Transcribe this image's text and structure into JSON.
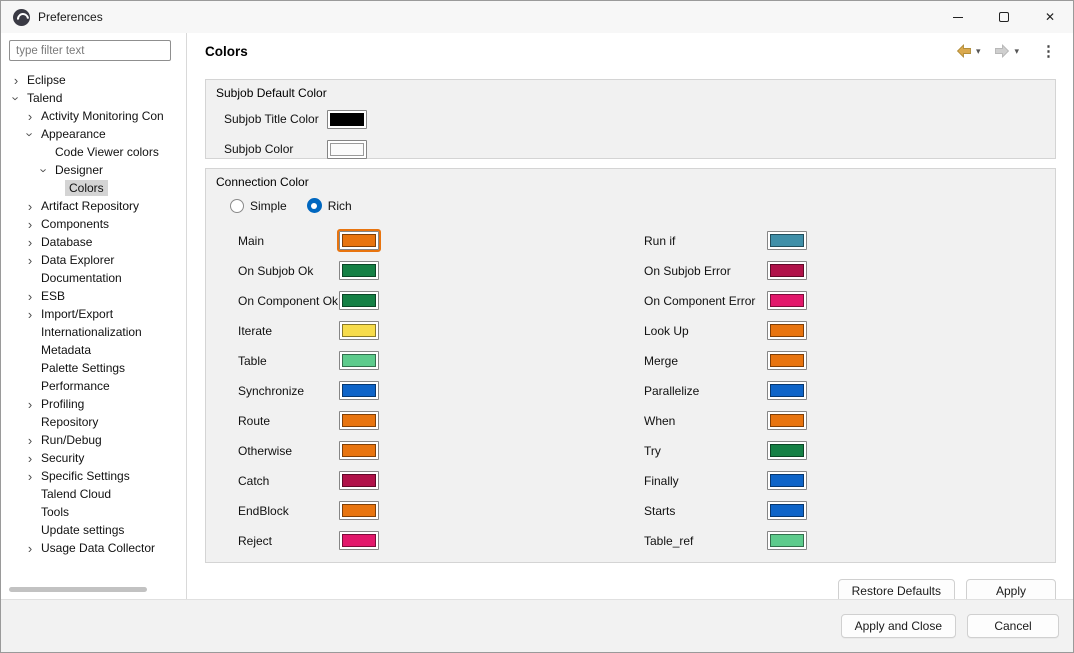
{
  "window": {
    "title": "Preferences"
  },
  "icons": {
    "close": "✕",
    "kebab": "⋮",
    "caret_down": "▾",
    "chevron": "›"
  },
  "sidebar": {
    "filter_placeholder": "type filter text",
    "tree": [
      {
        "label": "Eclipse",
        "level": 0,
        "arrow": "collapsed",
        "selected": false
      },
      {
        "label": "Talend",
        "level": 0,
        "arrow": "expanded",
        "selected": false
      },
      {
        "label": "Activity Monitoring Con",
        "level": 1,
        "arrow": "collapsed",
        "selected": false
      },
      {
        "label": "Appearance",
        "level": 1,
        "arrow": "expanded",
        "selected": false
      },
      {
        "label": "Code Viewer colors",
        "level": 2,
        "arrow": "none",
        "selected": false
      },
      {
        "label": "Designer",
        "level": 2,
        "arrow": "expanded",
        "selected": false
      },
      {
        "label": "Colors",
        "level": 3,
        "arrow": "none",
        "selected": true
      },
      {
        "label": "Artifact Repository",
        "level": 1,
        "arrow": "collapsed",
        "selected": false
      },
      {
        "label": "Components",
        "level": 1,
        "arrow": "collapsed",
        "selected": false
      },
      {
        "label": "Database",
        "level": 1,
        "arrow": "collapsed",
        "selected": false
      },
      {
        "label": "Data Explorer",
        "level": 1,
        "arrow": "collapsed",
        "selected": false
      },
      {
        "label": "Documentation",
        "level": 1,
        "arrow": "none",
        "selected": false
      },
      {
        "label": "ESB",
        "level": 1,
        "arrow": "collapsed",
        "selected": false
      },
      {
        "label": "Import/Export",
        "level": 1,
        "arrow": "collapsed",
        "selected": false
      },
      {
        "label": "Internationalization",
        "level": 1,
        "arrow": "none",
        "selected": false
      },
      {
        "label": "Metadata",
        "level": 1,
        "arrow": "none",
        "selected": false
      },
      {
        "label": "Palette Settings",
        "level": 1,
        "arrow": "none",
        "selected": false
      },
      {
        "label": "Performance",
        "level": 1,
        "arrow": "none",
        "selected": false
      },
      {
        "label": "Profiling",
        "level": 1,
        "arrow": "collapsed",
        "selected": false
      },
      {
        "label": "Repository",
        "level": 1,
        "arrow": "none",
        "selected": false
      },
      {
        "label": "Run/Debug",
        "level": 1,
        "arrow": "collapsed",
        "selected": false
      },
      {
        "label": "Security",
        "level": 1,
        "arrow": "collapsed",
        "selected": false
      },
      {
        "label": "Specific Settings",
        "level": 1,
        "arrow": "collapsed",
        "selected": false
      },
      {
        "label": "Talend Cloud",
        "level": 1,
        "arrow": "none",
        "selected": false
      },
      {
        "label": "Tools",
        "level": 1,
        "arrow": "none",
        "selected": false
      },
      {
        "label": "Update settings",
        "level": 1,
        "arrow": "none",
        "selected": false
      },
      {
        "label": "Usage Data Collector",
        "level": 1,
        "arrow": "collapsed",
        "selected": false
      }
    ]
  },
  "main": {
    "title": "Colors",
    "subjob_group": {
      "title": "Subjob Default Color",
      "rows": [
        {
          "label": "Subjob Title Color",
          "color": "#000000"
        },
        {
          "label": "Subjob Color",
          "color": "#FBFBFB"
        }
      ]
    },
    "connection_group": {
      "title": "Connection Color",
      "radios": [
        {
          "label": "Simple",
          "checked": false
        },
        {
          "label": "Rich",
          "checked": true
        }
      ],
      "left": [
        {
          "label": "Main",
          "color": "#E8740F",
          "focused": true
        },
        {
          "label": "On Subjob Ok",
          "color": "#158045"
        },
        {
          "label": "On Component Ok",
          "color": "#158045"
        },
        {
          "label": "Iterate",
          "color": "#F7DC4B"
        },
        {
          "label": "Table",
          "color": "#5DCB8C"
        },
        {
          "label": "Synchronize",
          "color": "#0E64C8"
        },
        {
          "label": "Route",
          "color": "#E8740F"
        },
        {
          "label": "Otherwise",
          "color": "#E8740F"
        },
        {
          "label": "Catch",
          "color": "#B01249"
        },
        {
          "label": "EndBlock",
          "color": "#E8740F"
        },
        {
          "label": "Reject",
          "color": "#E2186B"
        }
      ],
      "right": [
        {
          "label": "Run if",
          "color": "#3F8FA8"
        },
        {
          "label": "On Subjob Error",
          "color": "#B01249"
        },
        {
          "label": "On Component Error",
          "color": "#E2186B"
        },
        {
          "label": "Look Up",
          "color": "#E8740F"
        },
        {
          "label": "Merge",
          "color": "#E8740F"
        },
        {
          "label": "Parallelize",
          "color": "#0E64C8"
        },
        {
          "label": "When",
          "color": "#E8740F"
        },
        {
          "label": "Try",
          "color": "#158045"
        },
        {
          "label": "Finally",
          "color": "#0E64C8"
        },
        {
          "label": "Starts",
          "color": "#0E64C8"
        },
        {
          "label": "Table_ref",
          "color": "#5DCB8C"
        }
      ]
    },
    "buttons": {
      "restore": "Restore Defaults",
      "apply": "Apply"
    }
  },
  "footer": {
    "apply_and_close": "Apply and Close",
    "cancel": "Cancel"
  },
  "accent": "#0067C0"
}
